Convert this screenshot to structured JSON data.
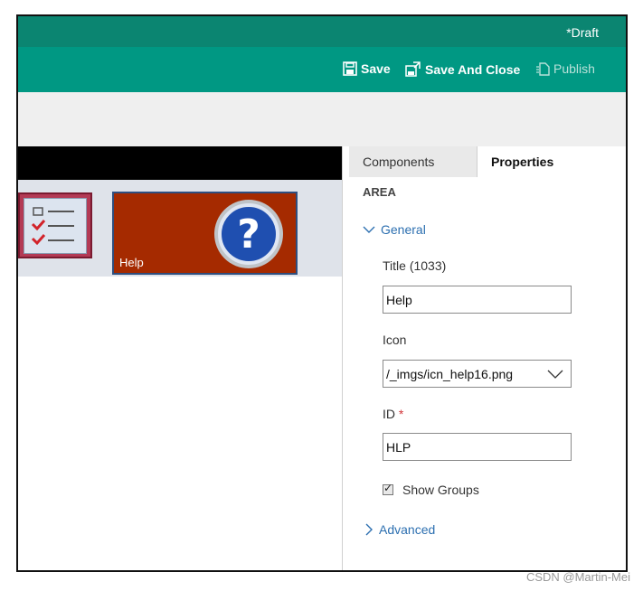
{
  "header": {
    "status": "*Draft"
  },
  "commands": {
    "save": "Save",
    "save_and_close": "Save And Close",
    "publish": "Publish"
  },
  "canvas": {
    "tile_help_label": "Help"
  },
  "panel": {
    "tabs": [
      {
        "label": "Components",
        "active": false
      },
      {
        "label": "Properties",
        "active": true
      }
    ],
    "area_title": "AREA",
    "general_section": "General",
    "advanced_section": "Advanced",
    "fields": {
      "title_label": "Title (1033)",
      "title_value": "Help",
      "icon_label": "Icon",
      "icon_value": "/_imgs/icn_help16.png",
      "id_label": "ID",
      "id_required_mark": "*",
      "id_value": "HLP",
      "show_groups_label": "Show Groups",
      "show_groups_checked": true
    }
  },
  "watermark": "CSDN @Martin-Mei",
  "colors": {
    "titlebar": "#0b8571",
    "commandbar": "#009883",
    "tile_help": "#a52a00",
    "link": "#2c6fb0"
  }
}
